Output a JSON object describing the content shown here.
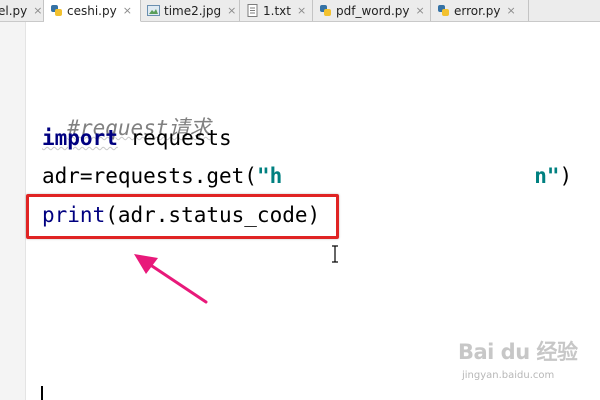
{
  "tabs": [
    {
      "label": "el.py",
      "icon": "python-file-icon",
      "active": false
    },
    {
      "label": "ceshi.py",
      "icon": "python-file-icon",
      "active": true
    },
    {
      "label": "time2.jpg",
      "icon": "image-file-icon",
      "active": false
    },
    {
      "label": "1.txt",
      "icon": "text-file-icon",
      "active": false
    },
    {
      "label": "pdf_word.py",
      "icon": "python-file-icon",
      "active": false
    },
    {
      "label": "error.py",
      "icon": "python-file-icon",
      "active": false
    }
  ],
  "close_glyph": "×",
  "code": {
    "comment": "#request请求",
    "import_keyword": "import",
    "import_module": " requests",
    "assign_prefix": "adr=requests.get(",
    "string_visible_start": "\"h",
    "string_visible_end": "n\"",
    "assign_suffix": ")",
    "print_builtin": "print",
    "print_args": "(adr.status_code)"
  },
  "watermark": {
    "logo_text": "Bai du 经验",
    "url": "jingyan.baidu.com"
  },
  "colors": {
    "highlight_box": "#e02424",
    "arrow": "#e8197a",
    "keyword": "#000080",
    "string": "#008080",
    "comment": "#808080"
  }
}
